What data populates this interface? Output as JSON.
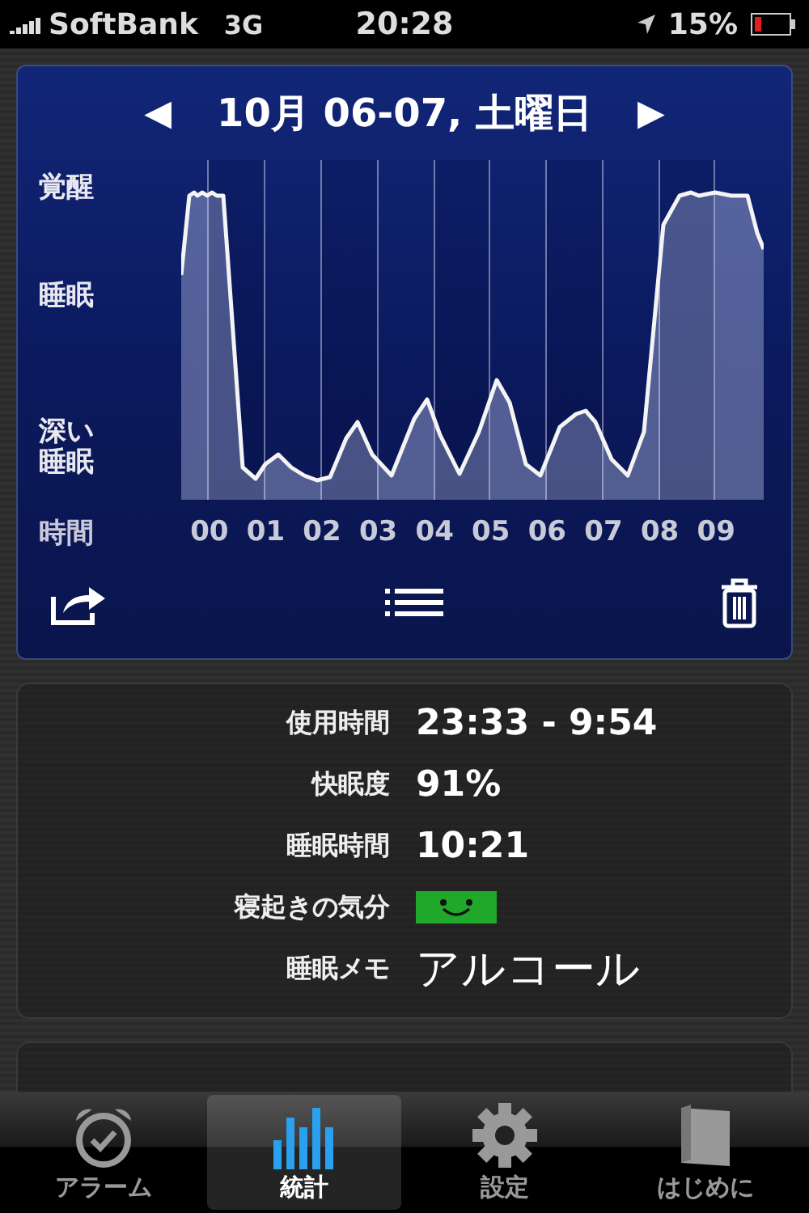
{
  "status_bar": {
    "carrier": "SoftBank",
    "network": "3G",
    "time": "20:28",
    "battery": "15%"
  },
  "chart_panel": {
    "prev": "◀",
    "title": "10月 06-07, 土曜日",
    "next": "▶",
    "y_labels": [
      "覚醒",
      "睡眠",
      "深い睡眠"
    ],
    "x_axis_label": "時間",
    "hours": [
      "00",
      "01",
      "02",
      "03",
      "04",
      "05",
      "06",
      "07",
      "08",
      "09"
    ]
  },
  "stats": [
    {
      "kind": "text",
      "label": "使用時間",
      "value": "23:33 - 9:54"
    },
    {
      "kind": "text",
      "label": "快眠度",
      "value": "91%"
    },
    {
      "kind": "text",
      "label": "睡眠時間",
      "value": "10:21"
    },
    {
      "kind": "mood",
      "label": "寝起きの気分"
    },
    {
      "kind": "memo",
      "label": "睡眠メモ",
      "value": "アルコール"
    }
  ],
  "tabs": [
    {
      "kind": "alarm",
      "label": "アラーム",
      "selected": false
    },
    {
      "kind": "stats",
      "label": "統計",
      "selected": true
    },
    {
      "kind": "settings",
      "label": "設定",
      "selected": false
    },
    {
      "kind": "intro",
      "label": "はじめに",
      "selected": false
    }
  ]
}
